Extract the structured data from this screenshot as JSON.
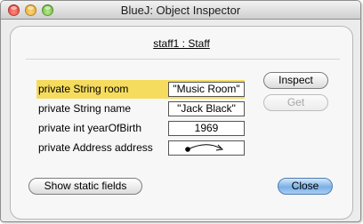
{
  "window": {
    "title": "BlueJ:  Object Inspector"
  },
  "object": {
    "header": "staff1 : Staff"
  },
  "fields": [
    {
      "label": "private String room",
      "value": "\"Music Room\"",
      "selected": true
    },
    {
      "label": "private String name",
      "value": "\"Jack Black\"",
      "selected": false
    },
    {
      "label": "private int yearOfBirth",
      "value": "1969",
      "selected": false
    },
    {
      "label": "private Address address",
      "value": "",
      "selected": false
    }
  ],
  "buttons": {
    "inspect": "Inspect",
    "get": "Get",
    "show_static": "Show static fields",
    "close": "Close"
  },
  "colors": {
    "selection": "#f6dc5e",
    "default_button": "#7bb0e6"
  }
}
